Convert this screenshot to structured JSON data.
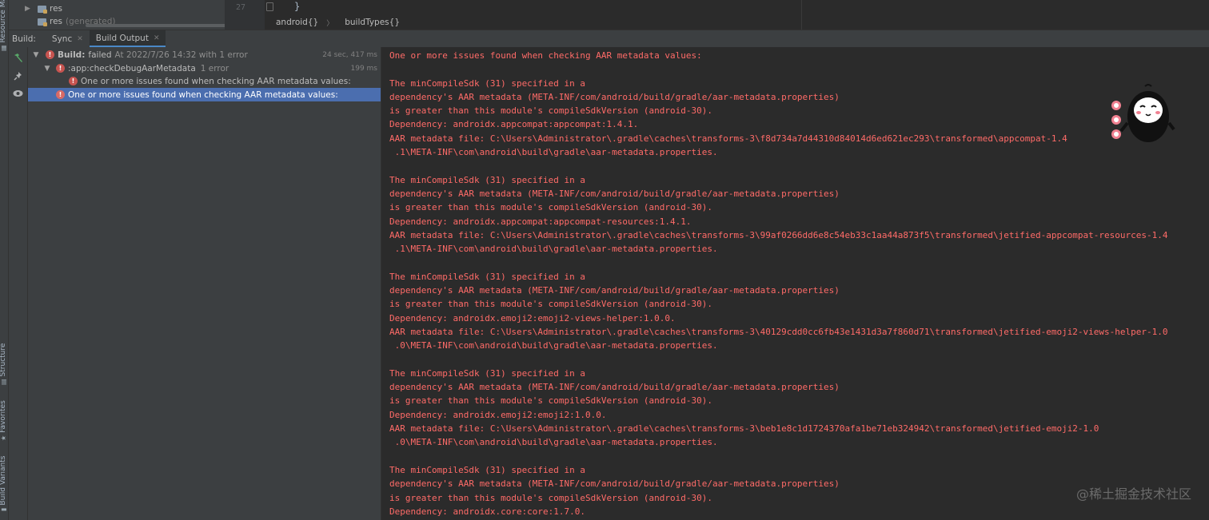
{
  "side_tabs": {
    "resource_manager": "Resource Manager",
    "structure": "Structure",
    "favorites": "Favorites",
    "build_variants": "Build Variants"
  },
  "project_tree": {
    "rows": [
      {
        "name": "res",
        "suffix": ""
      },
      {
        "name": "res",
        "suffix": "(generated)"
      }
    ]
  },
  "editor": {
    "line_number": "27",
    "code": "}",
    "breadcrumbs": [
      "android{}",
      "buildTypes{}"
    ]
  },
  "tool_window": {
    "title": "Build:",
    "tabs": [
      {
        "label": "Sync",
        "active": false
      },
      {
        "label": "Build Output",
        "active": true
      }
    ]
  },
  "build_tree": {
    "root": {
      "label": "Build:",
      "status": "failed",
      "detail": "At 2022/7/26 14:32 with 1 error",
      "time": "24 sec, 417 ms"
    },
    "task": {
      "label": ":app:checkDebugAarMetadata",
      "detail": "1 error",
      "time": "199 ms"
    },
    "task_issue": {
      "label": "One or more issues found when checking AAR metadata values:"
    },
    "selected_issue": {
      "label": "One or more issues found when checking AAR metadata values:"
    }
  },
  "console": {
    "lines": [
      "One or more issues found when checking AAR metadata values:",
      "",
      "The minCompileSdk (31) specified in a",
      "dependency's AAR metadata (META-INF/com/android/build/gradle/aar-metadata.properties)",
      "is greater than this module's compileSdkVersion (android-30).",
      "Dependency: androidx.appcompat:appcompat:1.4.1.",
      "AAR metadata file: C:\\Users\\Administrator\\.gradle\\caches\\transforms-3\\f8d734a7d44310d84014d6ed621ec293\\transformed\\appcompat-1.4",
      " .1\\META-INF\\com\\android\\build\\gradle\\aar-metadata.properties.",
      "",
      "The minCompileSdk (31) specified in a",
      "dependency's AAR metadata (META-INF/com/android/build/gradle/aar-metadata.properties)",
      "is greater than this module's compileSdkVersion (android-30).",
      "Dependency: androidx.appcompat:appcompat-resources:1.4.1.",
      "AAR metadata file: C:\\Users\\Administrator\\.gradle\\caches\\transforms-3\\99af0266dd6e8c54eb33c1aa44a873f5\\transformed\\jetified-appcompat-resources-1.4",
      " .1\\META-INF\\com\\android\\build\\gradle\\aar-metadata.properties.",
      "",
      "The minCompileSdk (31) specified in a",
      "dependency's AAR metadata (META-INF/com/android/build/gradle/aar-metadata.properties)",
      "is greater than this module's compileSdkVersion (android-30).",
      "Dependency: androidx.emoji2:emoji2-views-helper:1.0.0.",
      "AAR metadata file: C:\\Users\\Administrator\\.gradle\\caches\\transforms-3\\40129cdd0cc6fb43e1431d3a7f860d71\\transformed\\jetified-emoji2-views-helper-1.0",
      " .0\\META-INF\\com\\android\\build\\gradle\\aar-metadata.properties.",
      "",
      "The minCompileSdk (31) specified in a",
      "dependency's AAR metadata (META-INF/com/android/build/gradle/aar-metadata.properties)",
      "is greater than this module's compileSdkVersion (android-30).",
      "Dependency: androidx.emoji2:emoji2:1.0.0.",
      "AAR metadata file: C:\\Users\\Administrator\\.gradle\\caches\\transforms-3\\beb1e8c1d1724370afa1be71eb324942\\transformed\\jetified-emoji2-1.0",
      " .0\\META-INF\\com\\android\\build\\gradle\\aar-metadata.properties.",
      "",
      "The minCompileSdk (31) specified in a",
      "dependency's AAR metadata (META-INF/com/android/build/gradle/aar-metadata.properties)",
      "is greater than this module's compileSdkVersion (android-30).",
      "Dependency: androidx.core:core:1.7.0."
    ]
  },
  "watermark": "@稀土掘金技术社区",
  "colors": {
    "error_text": "#ff6b68",
    "selection": "#4b6eaf",
    "success_icon": "#59a869",
    "error_icon": "#c75450"
  }
}
